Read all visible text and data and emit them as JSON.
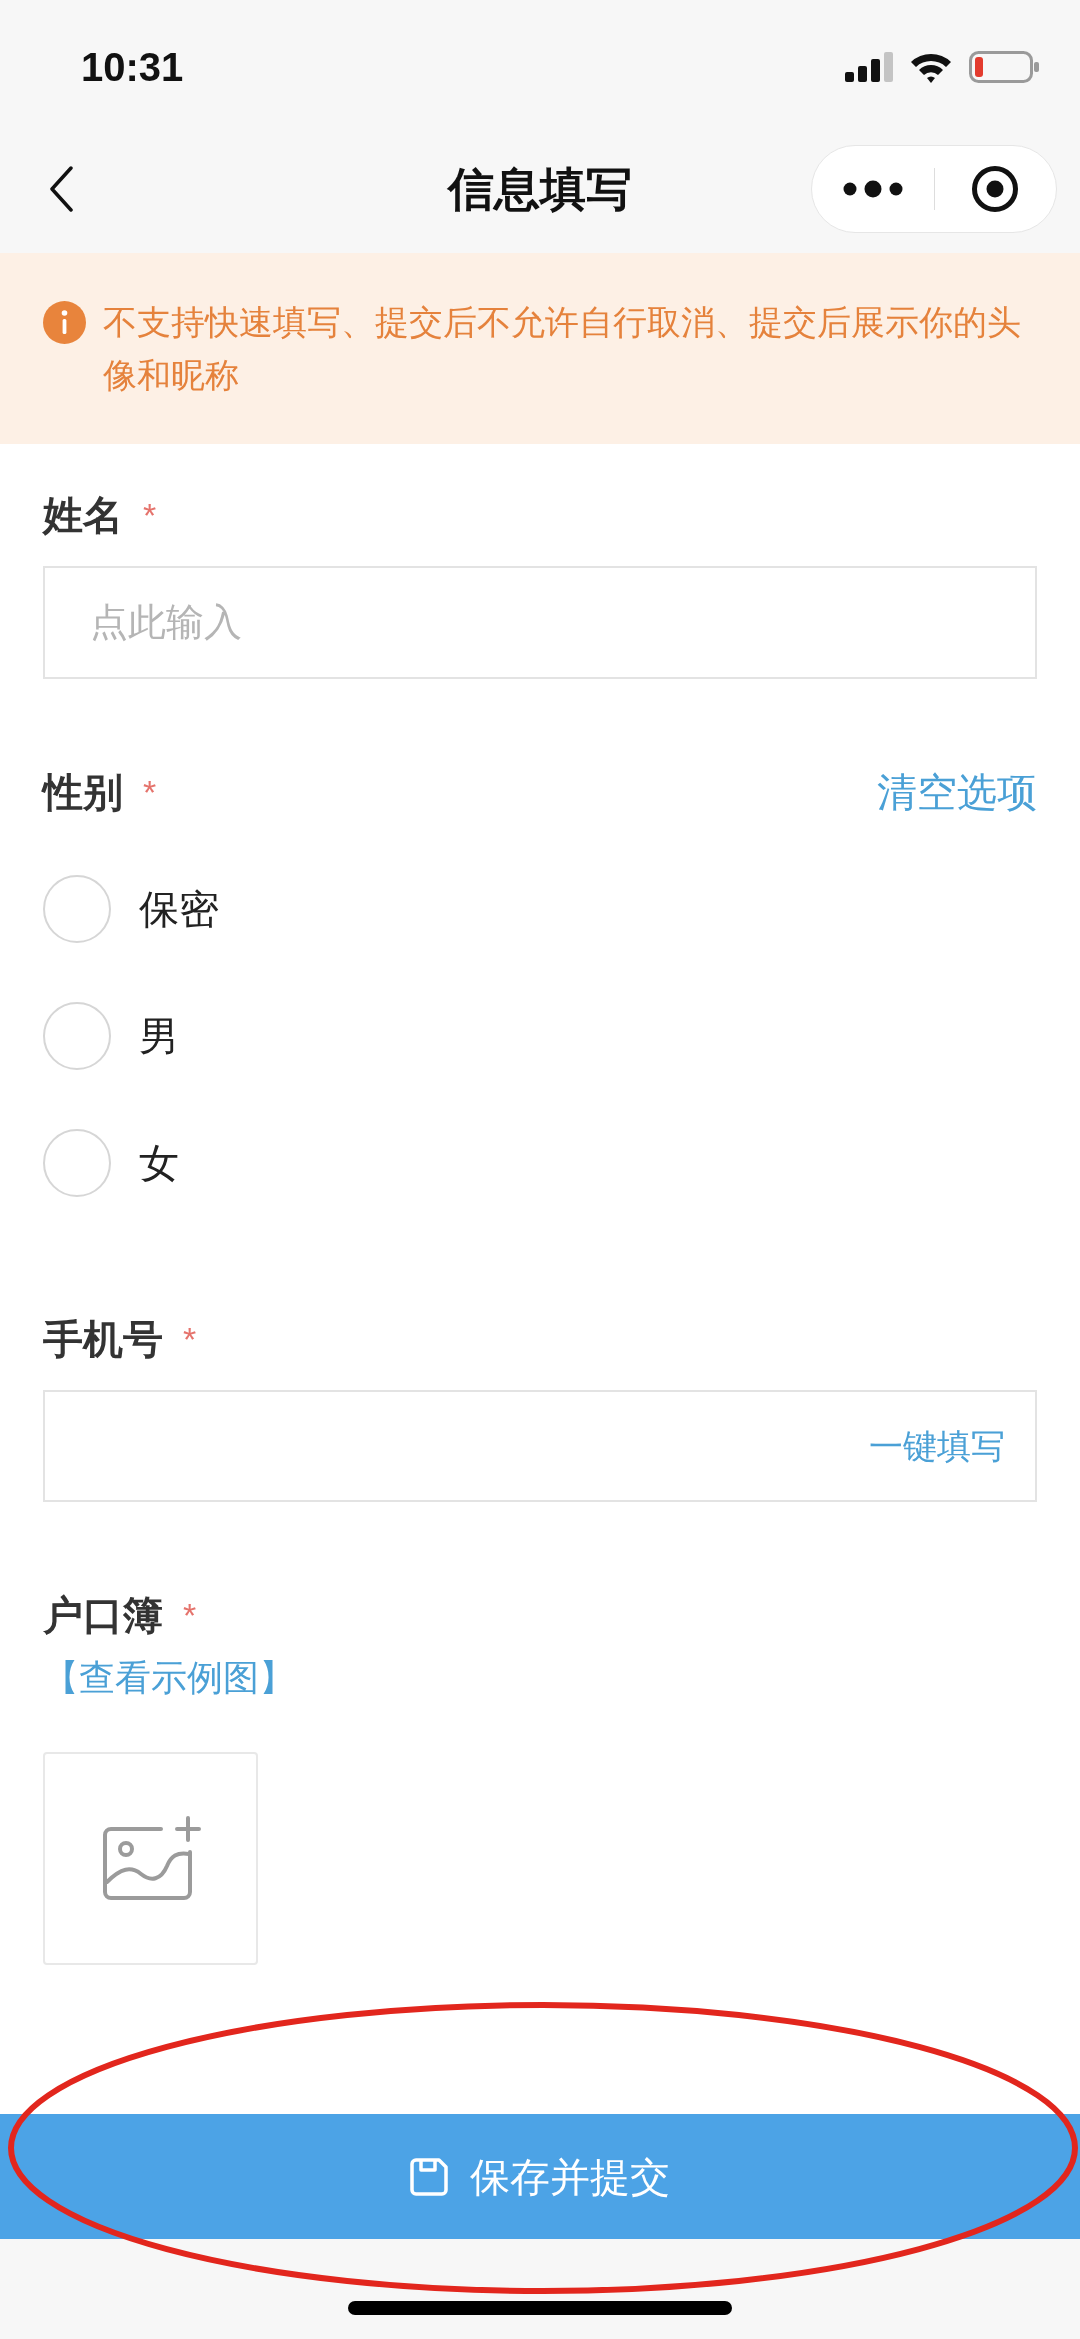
{
  "status_bar": {
    "time": "10:31"
  },
  "nav_bar": {
    "title": "信息填写"
  },
  "notice": {
    "text": "不支持快速填写、提交后不允许自行取消、提交后展示你的头像和昵称"
  },
  "fields": [
    {
      "kind": "text",
      "label": "姓名",
      "required_mark": "*",
      "placeholder": "点此输入"
    },
    {
      "kind": "radio",
      "label": "性别",
      "required_mark": "*",
      "clear_link": "清空选项",
      "options": [
        {
          "label": "保密",
          "selected": false
        },
        {
          "label": "男",
          "selected": false
        },
        {
          "label": "女",
          "selected": false
        }
      ]
    },
    {
      "kind": "phone",
      "label": "手机号",
      "required_mark": "*",
      "action": "一键填写"
    },
    {
      "kind": "upload",
      "label": "户口簿",
      "required_mark": "*",
      "example_link": "【查看示例图】"
    }
  ],
  "submit_button": {
    "label": "保存并提交"
  }
}
